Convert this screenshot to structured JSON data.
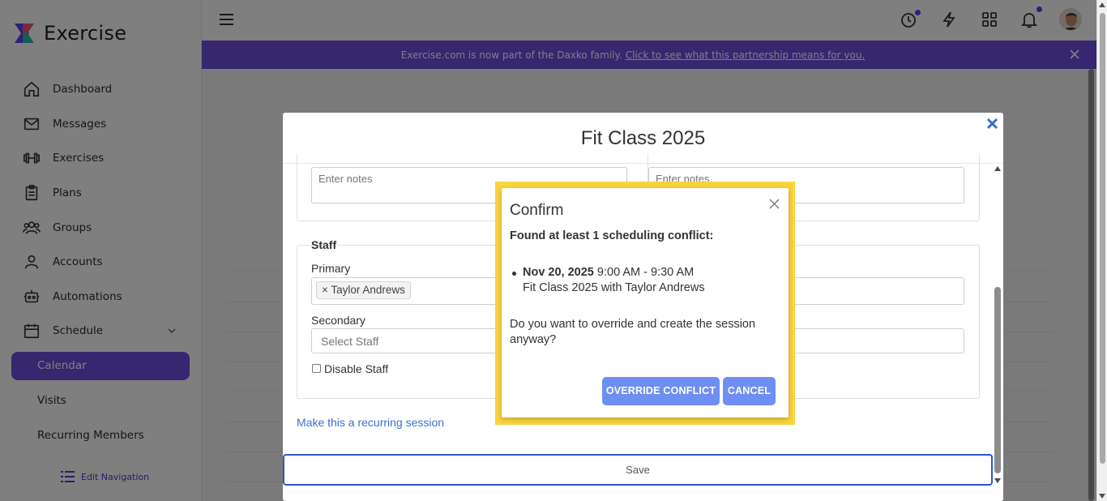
{
  "app": {
    "name": "Exercise",
    "colors": {
      "accent": "#6c4fe0",
      "confirm_highlight": "#fbd33d",
      "button": "#6f8ef1",
      "link": "#3b6fd1"
    }
  },
  "sidebar": {
    "items": [
      {
        "label": "Dashboard",
        "icon": "home-icon"
      },
      {
        "label": "Messages",
        "icon": "envelope-icon"
      },
      {
        "label": "Exercises",
        "icon": "dumbbell-icon"
      },
      {
        "label": "Plans",
        "icon": "clipboard-icon"
      },
      {
        "label": "Groups",
        "icon": "users-icon"
      },
      {
        "label": "Accounts",
        "icon": "user-icon"
      },
      {
        "label": "Automations",
        "icon": "robot-icon"
      },
      {
        "label": "Schedule",
        "icon": "calendar-icon"
      }
    ],
    "sub_items": [
      {
        "label": "Calendar",
        "active": true
      },
      {
        "label": "Visits",
        "active": false
      },
      {
        "label": "Recurring Members",
        "active": false
      }
    ],
    "edit_navigation": "Edit Navigation"
  },
  "header": {
    "icons": [
      "menu-icon",
      "clock-icon",
      "lightning-icon",
      "grid-icon",
      "bell-icon",
      "avatar"
    ]
  },
  "banner": {
    "text": "Exercise.com is now part of the Daxko family.",
    "link": "Click to see what this partnership means for you."
  },
  "session_modal": {
    "title": "Fit Class 2025",
    "notes_placeholder_left": "Enter notes",
    "notes_placeholder_right": "Enter notes",
    "staff_heading": "Staff",
    "primary_label": "Primary",
    "primary_tag": "Taylor Andrews",
    "secondary_label": "Secondary",
    "secondary_placeholder": "Select Staff",
    "disable_staff_label": "Disable Staff",
    "recurring_link": "Make this a recurring session",
    "save_label": "Save"
  },
  "confirm": {
    "title": "Confirm",
    "heading": "Found at least 1 scheduling conflict:",
    "conflict_date": "Nov 20, 2025",
    "conflict_time": "9:00 AM - 9:30 AM",
    "conflict_desc": "Fit Class 2025 with Taylor Andrews",
    "question": "Do you want to override and create the session anyway?",
    "override_label": "OVERRIDE CONFLICT",
    "cancel_label": "CANCEL"
  }
}
